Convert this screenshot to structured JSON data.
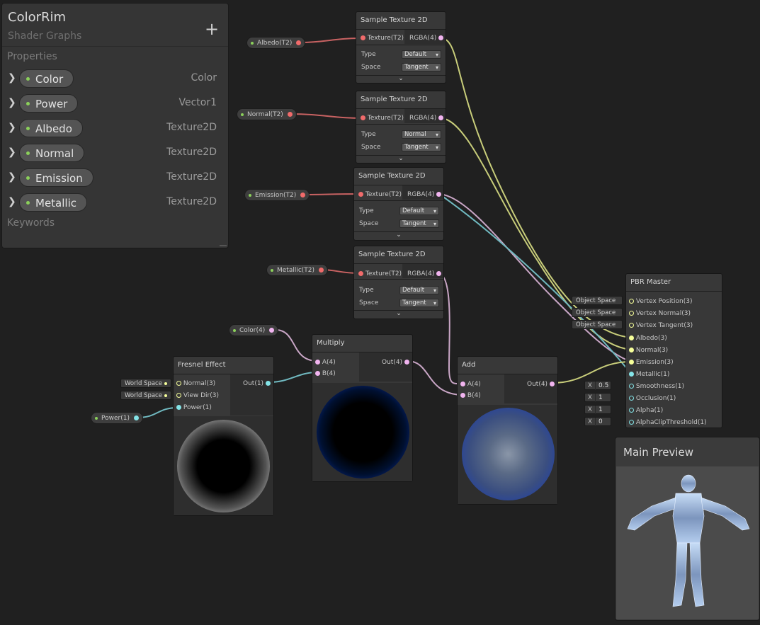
{
  "blackboard": {
    "title": "ColorRim",
    "subtitle": "Shader Graphs",
    "add_label": "+",
    "properties_header": "Properties",
    "keywords_header": "Keywords",
    "properties": [
      {
        "name": "Color",
        "type": "Color"
      },
      {
        "name": "Power",
        "type": "Vector1"
      },
      {
        "name": "Albedo",
        "type": "Texture2D"
      },
      {
        "name": "Normal",
        "type": "Texture2D"
      },
      {
        "name": "Emission",
        "type": "Texture2D"
      },
      {
        "name": "Metallic",
        "type": "Texture2D"
      }
    ]
  },
  "pills": {
    "albedo": "Albedo(T2)",
    "normal": "Normal(T2)",
    "emission": "Emission(T2)",
    "metallic": "Metallic(T2)",
    "color": "Color(4)",
    "power": "Power(1)"
  },
  "sample_nodes": [
    {
      "title": "Sample Texture 2D",
      "input": "Texture(T2)",
      "output": "RGBA(4)",
      "type_label": "Type",
      "type_value": "Default",
      "space_label": "Space",
      "space_value": "Tangent",
      "expand": "⌄"
    },
    {
      "title": "Sample Texture 2D",
      "input": "Texture(T2)",
      "output": "RGBA(4)",
      "type_label": "Type",
      "type_value": "Normal",
      "space_label": "Space",
      "space_value": "Tangent",
      "expand": "⌄"
    },
    {
      "title": "Sample Texture 2D",
      "input": "Texture(T2)",
      "output": "RGBA(4)",
      "type_label": "Type",
      "type_value": "Default",
      "space_label": "Space",
      "space_value": "Tangent",
      "expand": "⌄"
    },
    {
      "title": "Sample Texture 2D",
      "input": "Texture(T2)",
      "output": "RGBA(4)",
      "type_label": "Type",
      "type_value": "Default",
      "space_label": "Space",
      "space_value": "Tangent",
      "expand": "⌄"
    }
  ],
  "fresnel": {
    "title": "Fresnel Effect",
    "inputs": [
      "Normal(3)",
      "View Dir(3)",
      "Power(1)"
    ],
    "output": "Out(1)",
    "inline_normal": "World Space",
    "inline_view": "World Space"
  },
  "multiply": {
    "title": "Multiply",
    "inputs": [
      "A(4)",
      "B(4)"
    ],
    "output": "Out(4)"
  },
  "add": {
    "title": "Add",
    "inputs": [
      "A(4)",
      "B(4)"
    ],
    "output": "Out(4)"
  },
  "pbr": {
    "title": "PBR Master",
    "inputs": [
      "Vertex Position(3)",
      "Vertex Normal(3)",
      "Vertex Tangent(3)",
      "Albedo(3)",
      "Normal(3)",
      "Emission(3)",
      "Metallic(1)",
      "Smoothness(1)",
      "Occlusion(1)",
      "Alpha(1)",
      "AlphaClipThreshold(1)"
    ],
    "space_labels": [
      "Object Space",
      "Object Space",
      "Object Space"
    ],
    "x_label": "X",
    "values": [
      "0.5",
      "1",
      "1",
      "0"
    ]
  },
  "main_preview": {
    "title": "Main Preview"
  },
  "colors": {
    "texture_wire": "#c86262",
    "vector4_wire": "#c9a6c6",
    "vector3_wire": "#c8cd7a",
    "vector1_wire": "#70b9c0"
  }
}
